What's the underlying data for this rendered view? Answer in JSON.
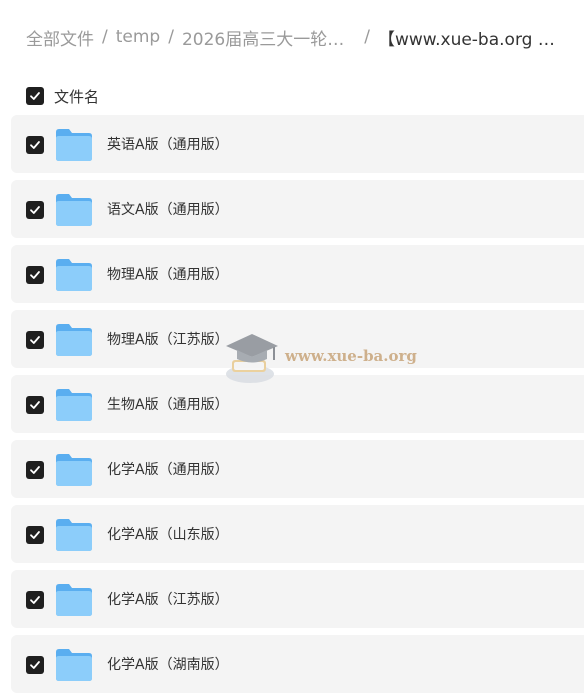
{
  "breadcrumb": {
    "items": [
      "全部文件",
      "temp",
      "2026届高三大一轮…",
      "【www.xue-ba.org …"
    ],
    "separator": "/"
  },
  "header": {
    "column_label": "文件名"
  },
  "files": [
    {
      "name": "英语A版（通用版）"
    },
    {
      "name": "语文A版（通用版）"
    },
    {
      "name": "物理A版（通用版）"
    },
    {
      "name": "物理A版（江苏版）"
    },
    {
      "name": "生物A版（通用版）"
    },
    {
      "name": "化学A版（通用版）"
    },
    {
      "name": "化学A版（山东版）"
    },
    {
      "name": "化学A版（江苏版）"
    },
    {
      "name": "化学A版（湖南版）"
    }
  ],
  "watermark": {
    "text": "www.xue-ba.org"
  },
  "colors": {
    "checkbox": "#1f1f1f",
    "row_bg": "#f4f4f4",
    "folder": "#7cc4f7",
    "watermark": "#c8a57a"
  },
  "icons": {
    "folder": "folder-icon",
    "check": "check-icon",
    "watermark": "graduation-cap-icon"
  }
}
